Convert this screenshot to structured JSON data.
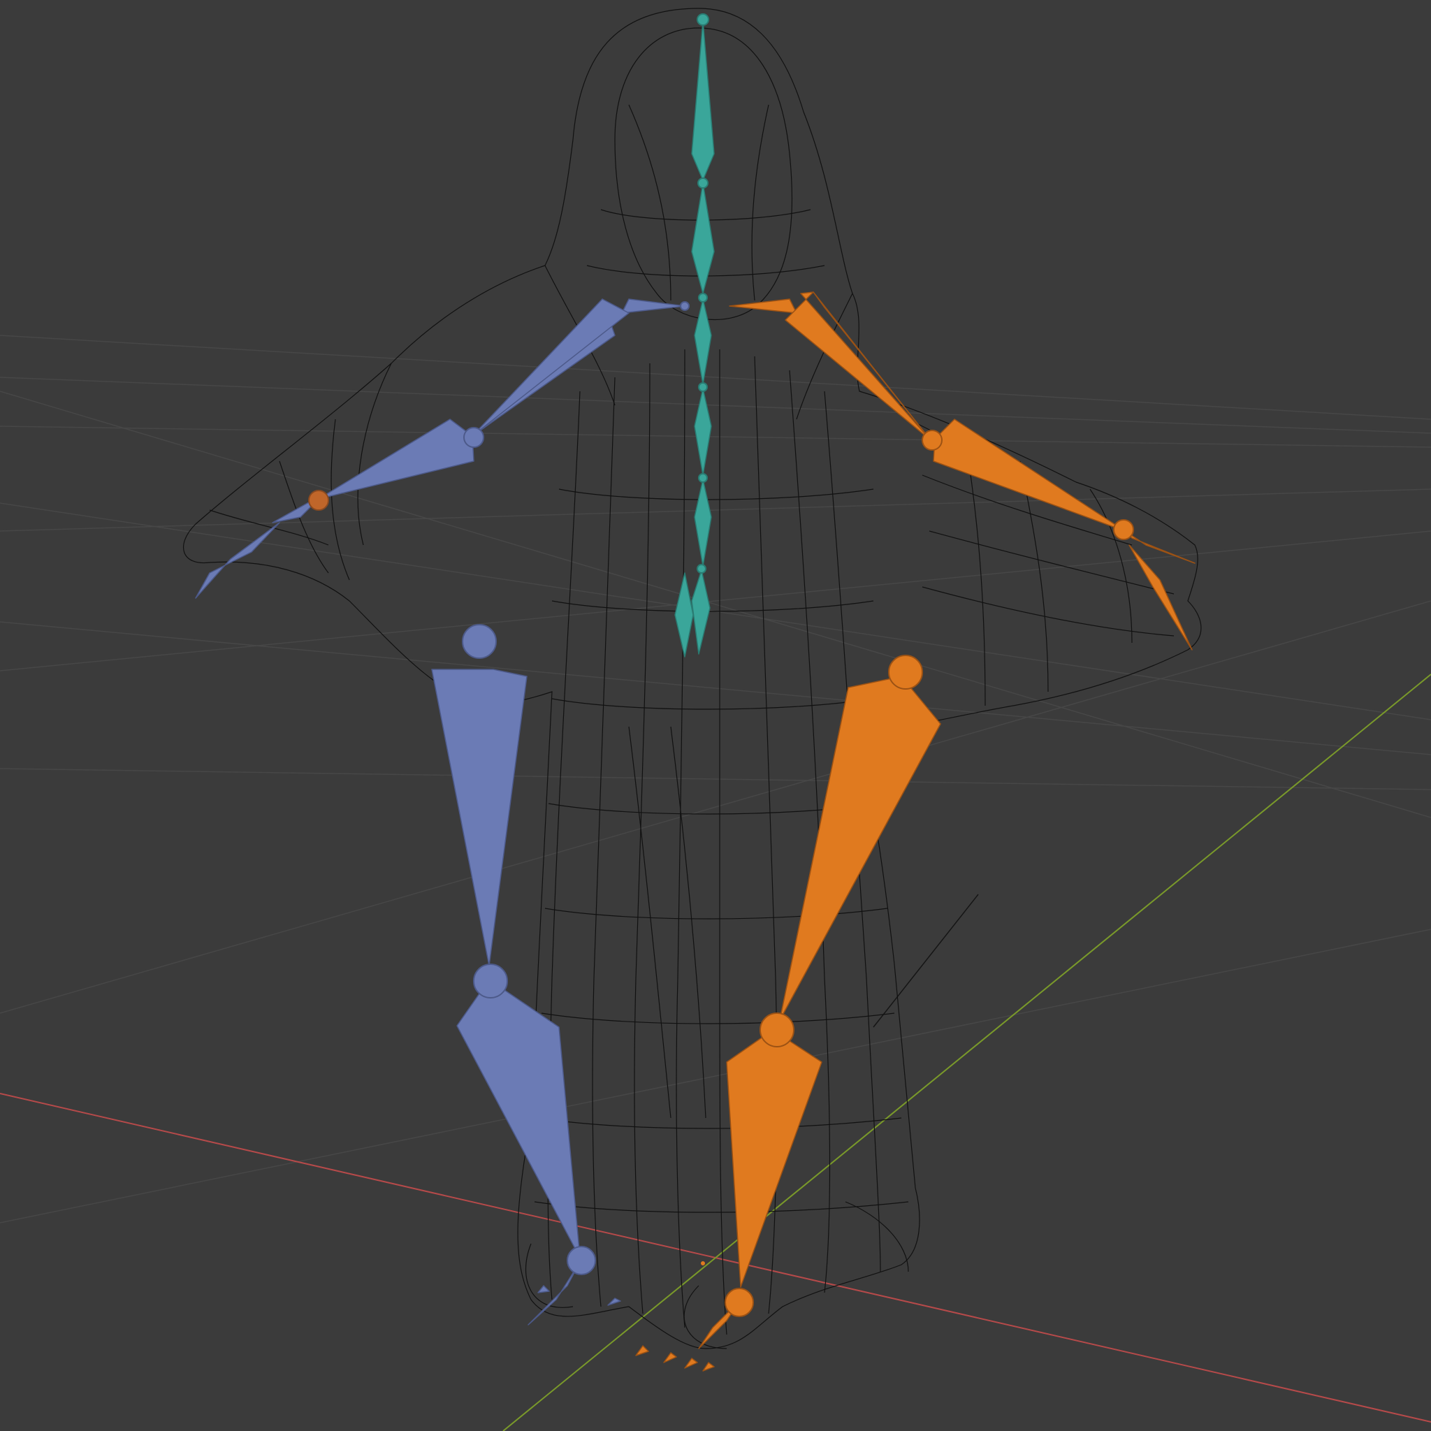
{
  "viewport": {
    "name": "3D Viewport",
    "background": "#3b3b3b",
    "grid_color": "#4a4a4a",
    "x_axis_color": "#b64a4a",
    "y_axis_color": "#7a9a2a"
  },
  "armature": {
    "left_side_color": "#6b7bb5",
    "right_side_color": "#e07a1f",
    "center_color": "#3aa69a",
    "left_bones": [
      "upper-arm",
      "forearm",
      "hand",
      "thigh",
      "shin",
      "foot"
    ],
    "right_bones": [
      "upper-arm",
      "forearm",
      "hand",
      "thigh",
      "shin",
      "foot"
    ],
    "center_bones": [
      "head",
      "neck",
      "spine-1",
      "spine-2",
      "spine-3",
      "spine-4",
      "tail"
    ]
  },
  "mesh": {
    "display": "wireframe",
    "wire_color": "#111111"
  }
}
